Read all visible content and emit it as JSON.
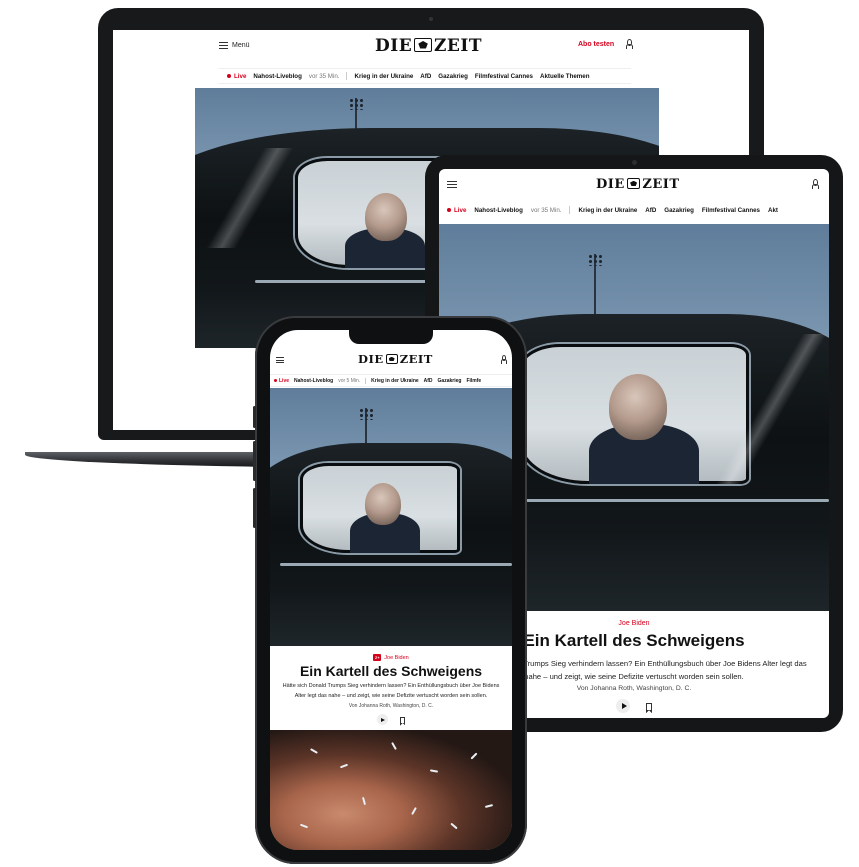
{
  "brand": {
    "logo_left": "DIE",
    "logo_right": "ZEIT",
    "accent_color": "#d5001c"
  },
  "header": {
    "menu_label": "Menü",
    "subscribe_label": "Abo testen"
  },
  "nav": {
    "live_label": "Live",
    "items": [
      "Nahost-Liveblog",
      "Krieg in der Ukraine",
      "AfD",
      "Gazakrieg",
      "Filmfestival Cannes",
      "Aktuelle Themen"
    ],
    "ago_laptop": "vor 35 Min.",
    "ago_tablet": "vor 35 Min.",
    "ago_phone": "vor 5 Min.",
    "tablet_cut": "Akt",
    "phone_cut": "Filmfe"
  },
  "article": {
    "kicker": "Joe Biden",
    "headline": "Ein Kartell des Schweigens",
    "teaser_phone": "Hätte sich Donald Trumps Sieg verhindern lassen? Ein Enthüllungsbuch über Joe Bidens Alter legt das nahe – und zeigt, wie seine Defizite vertuscht worden sein sollen.",
    "teaser_tablet_1": "Hätte sich Donald Trumps Sieg verhindern lassen? Ein Enthüllungsbuch über Joe Bidens Alter legt das",
    "teaser_tablet_2": "nahe – und zeigt, wie seine Defizite vertuscht worden sein sollen.",
    "byline": "Von Johanna Roth, Washington, D. C.",
    "zplus_badge": "Z+"
  },
  "icons": [
    "menu-icon",
    "account-icon",
    "play-icon",
    "bookmark-icon",
    "eagle-logo-icon"
  ]
}
